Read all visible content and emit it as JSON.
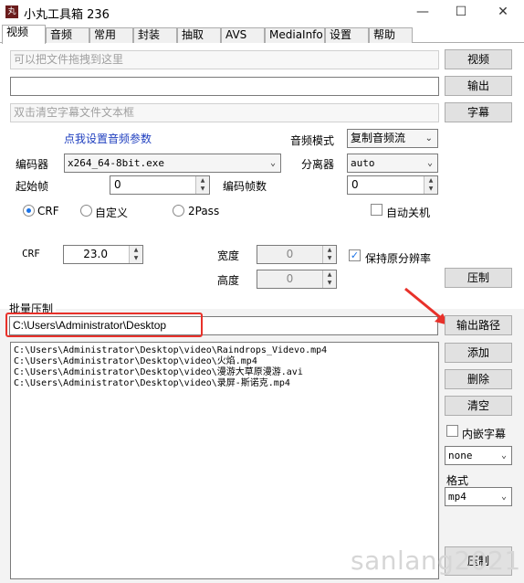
{
  "window": {
    "title": "小丸工具箱 236",
    "app_icon": "丸",
    "minimize": "—",
    "maximize": "☐",
    "close": "✕"
  },
  "tabs": [
    "视频",
    "音频",
    "常用",
    "封装",
    "抽取",
    "AVS",
    "MediaInfo",
    "设置",
    "帮助"
  ],
  "inputs": {
    "video_placeholder": "可以把文件拖拽到这里",
    "output_value": "",
    "subtitle_placeholder": "双击清空字幕文件文本框"
  },
  "buttons": {
    "video": "视频",
    "output": "输出",
    "subtitle": "字幕",
    "compress": "压制",
    "output_path": "输出路径",
    "add": "添加",
    "delete": "删除",
    "clear": "清空",
    "batch_compress": "压制"
  },
  "audio_link": "点我设置音频参数",
  "audio_mode": {
    "label": "音频模式",
    "value": "复制音频流"
  },
  "encoder": {
    "label": "编码器",
    "value": "x264_64-8bit.exe"
  },
  "splitter": {
    "label": "分离器",
    "value": "auto"
  },
  "start_frame": {
    "label": "起始帧",
    "value": "0"
  },
  "frame_count": {
    "label": "编码帧数",
    "value": "0"
  },
  "auto_shutdown": "自动关机",
  "rate_modes": {
    "crf": "CRF",
    "custom": "自定义",
    "twopass": "2Pass",
    "selected": "CRF"
  },
  "crf": {
    "label": "CRF",
    "value": "23.0"
  },
  "width": {
    "label": "宽度",
    "value": "0"
  },
  "height": {
    "label": "高度",
    "value": "0"
  },
  "keep_resolution": {
    "label": "保持原分辨率",
    "checked": true
  },
  "batch": {
    "label": "批量压制",
    "output_path": "C:\\Users\\Administrator\\Desktop",
    "files": [
      "C:\\Users\\Administrator\\Desktop\\video\\Raindrops_Videvo.mp4",
      "C:\\Users\\Administrator\\Desktop\\video\\火焰.mp4",
      "C:\\Users\\Administrator\\Desktop\\video\\漫游大草原漫游.avi",
      "C:\\Users\\Administrator\\Desktop\\video\\录屏-斯诺克.mp4"
    ],
    "embed_subtitle": "内嵌字幕",
    "subtitle_option": "none",
    "format_label": "格式",
    "format_value": "mp4"
  },
  "watermark": "sanlang2021",
  "colors": {
    "annotation": "#e8312a",
    "link": "#1f3fbf"
  }
}
